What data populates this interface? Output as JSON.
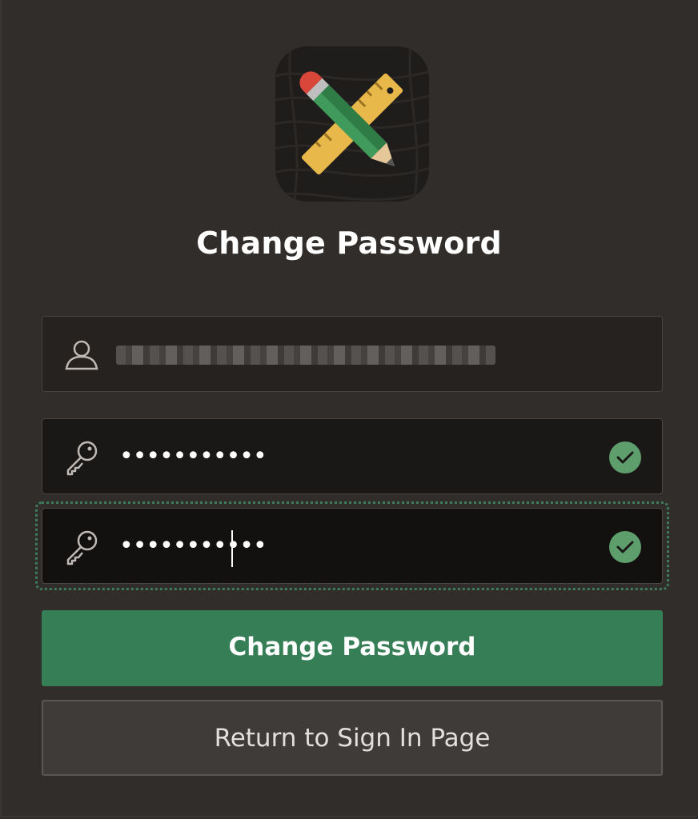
{
  "page": {
    "title": "Change Password"
  },
  "logo": {
    "icon": "pencil-ruler-icon"
  },
  "form": {
    "username": {
      "icon": "user-icon",
      "value_obscured": true
    },
    "new_password": {
      "icon": "key-icon",
      "masked_value": "•••••••••••",
      "status_icon": "check-circle-icon"
    },
    "confirm_password": {
      "icon": "key-icon",
      "masked_value": "•••••••••••",
      "status_icon": "check-circle-icon",
      "focused": true
    }
  },
  "buttons": {
    "change_password": "Change Password",
    "return_to_sign_in": "Return to Sign In Page"
  },
  "colors": {
    "background": "#312d2a",
    "primary_button": "#367e56",
    "valid_check": "#5e9e6c",
    "focus_ring": "#3e7d5c"
  }
}
